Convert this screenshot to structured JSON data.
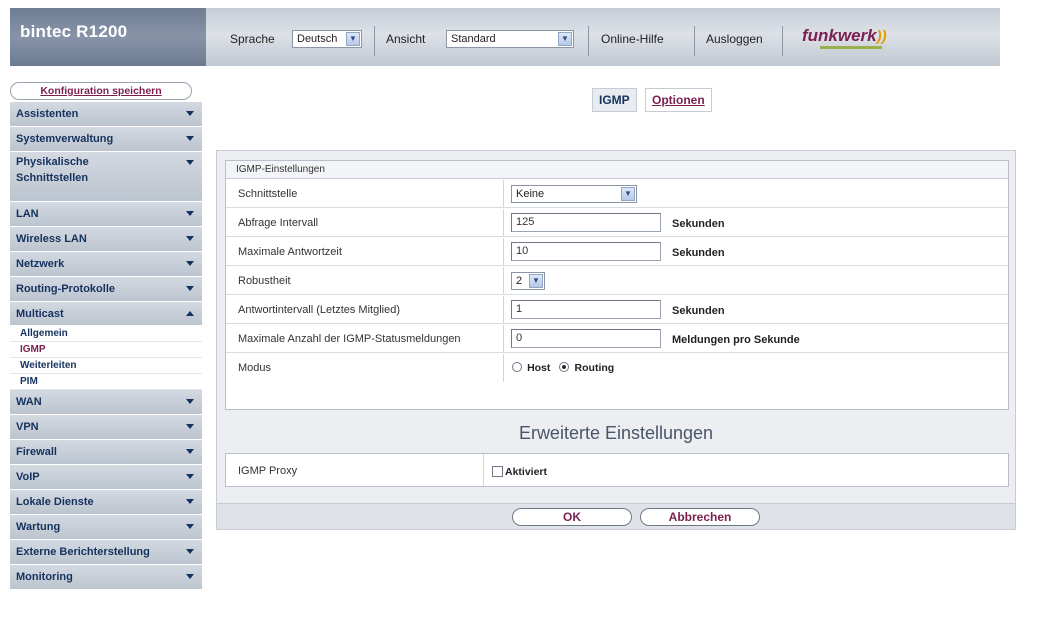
{
  "header": {
    "brand": "bintec R1200",
    "language_label": "Sprache",
    "language_value": "Deutsch",
    "view_label": "Ansicht",
    "view_value": "Standard",
    "help_label": "Online-Hilfe",
    "logout_label": "Ausloggen",
    "logo_text": "funkwerk"
  },
  "sidebar": {
    "save_label": "Konfiguration speichern",
    "items": {
      "assistenten": "Assistenten",
      "systemverwaltung": "Systemverwaltung",
      "physikalische": "Physikalische",
      "schnittstellen": "Schnittstellen",
      "lan": "LAN",
      "wireless": "Wireless LAN",
      "netzwerk": "Netzwerk",
      "routing": "Routing-Protokolle",
      "multicast": "Multicast",
      "wan": "WAN",
      "vpn": "VPN",
      "firewall": "Firewall",
      "voip": "VoIP",
      "lokale": "Lokale Dienste",
      "wartung": "Wartung",
      "externe": "Externe Berichterstellung",
      "monitoring": "Monitoring"
    },
    "multicast_sub": {
      "allgemein": "Allgemein",
      "igmp": "IGMP",
      "weiterleiten": "Weiterleiten",
      "pim": "PIM"
    }
  },
  "tabs": {
    "igmp": "IGMP",
    "optionen": "Optionen"
  },
  "form": {
    "section_title": "IGMP-Einstellungen",
    "schnittstelle": {
      "label": "Schnittstelle",
      "value": "Keine"
    },
    "abfrage": {
      "label": "Abfrage Intervall",
      "value": "125",
      "unit": "Sekunden"
    },
    "antwortzeit": {
      "label": "Maximale Antwortzeit",
      "value": "10",
      "unit": "Sekunden"
    },
    "robustheit": {
      "label": "Robustheit",
      "value": "2"
    },
    "antwortintervall": {
      "label": "Antwortintervall (Letztes Mitglied)",
      "value": "1",
      "unit": "Sekunden"
    },
    "max_status": {
      "label": "Maximale Anzahl der IGMP-Statusmeldungen",
      "value": "0",
      "unit": "Meldungen pro Sekunde"
    },
    "modus": {
      "label": "Modus",
      "host": "Host",
      "routing": "Routing",
      "selected": "Routing"
    },
    "advanced_title": "Erweiterte Einstellungen",
    "proxy": {
      "label": "IGMP Proxy",
      "checkbox_label": "Aktiviert",
      "checked": false
    }
  },
  "buttons": {
    "ok": "OK",
    "cancel": "Abbrechen"
  },
  "colors": {
    "accent": "#7a1f4f",
    "nav_text": "#14325e",
    "nav_bg": "#c8ced8",
    "brand_bg": "#7b889d"
  }
}
